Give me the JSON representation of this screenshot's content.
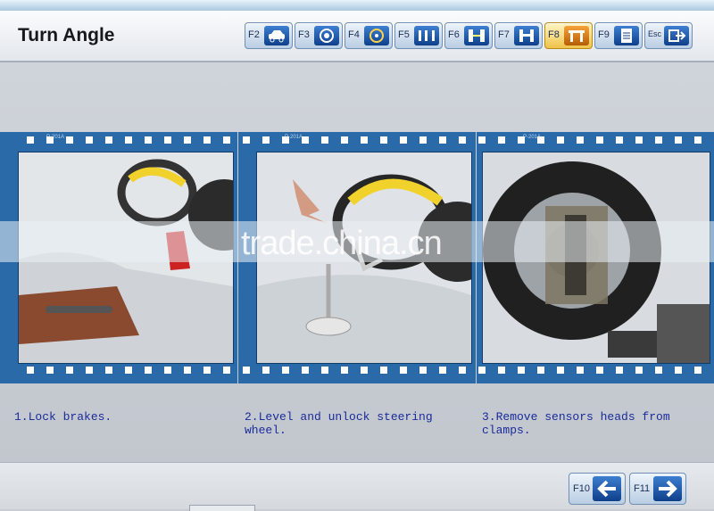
{
  "header": {
    "title": "Turn Angle"
  },
  "fkeys": [
    {
      "label": "F2",
      "icon": "car-icon"
    },
    {
      "label": "F3",
      "icon": "wheel-target-icon"
    },
    {
      "label": "F4",
      "icon": "steering-icon"
    },
    {
      "label": "F5",
      "icon": "axle-icon"
    },
    {
      "label": "F6",
      "icon": "sensor-icon"
    },
    {
      "label": "F7",
      "icon": "alignment-icon"
    },
    {
      "label": "F8",
      "icon": "turn-angle-icon",
      "active": true
    },
    {
      "label": "F9",
      "icon": "report-icon"
    },
    {
      "label": "Esc",
      "icon": "exit-icon"
    }
  ],
  "frames": [
    {
      "code": "P-201A",
      "caption": "1.Lock brakes."
    },
    {
      "code": "P-201A",
      "caption": "2.Level and unlock steering wheel."
    },
    {
      "code": "P-201A",
      "caption": "3.Remove sensors heads from clamps."
    }
  ],
  "watermark": "trade.china.cn",
  "footer": {
    "back": {
      "label": "F10",
      "icon": "arrow-left-icon"
    },
    "next": {
      "label": "F11",
      "icon": "arrow-right-icon"
    }
  },
  "colors": {
    "accent": "#2a6aa9",
    "caption": "#1a2a9a",
    "active_key": "#f0c24a"
  }
}
